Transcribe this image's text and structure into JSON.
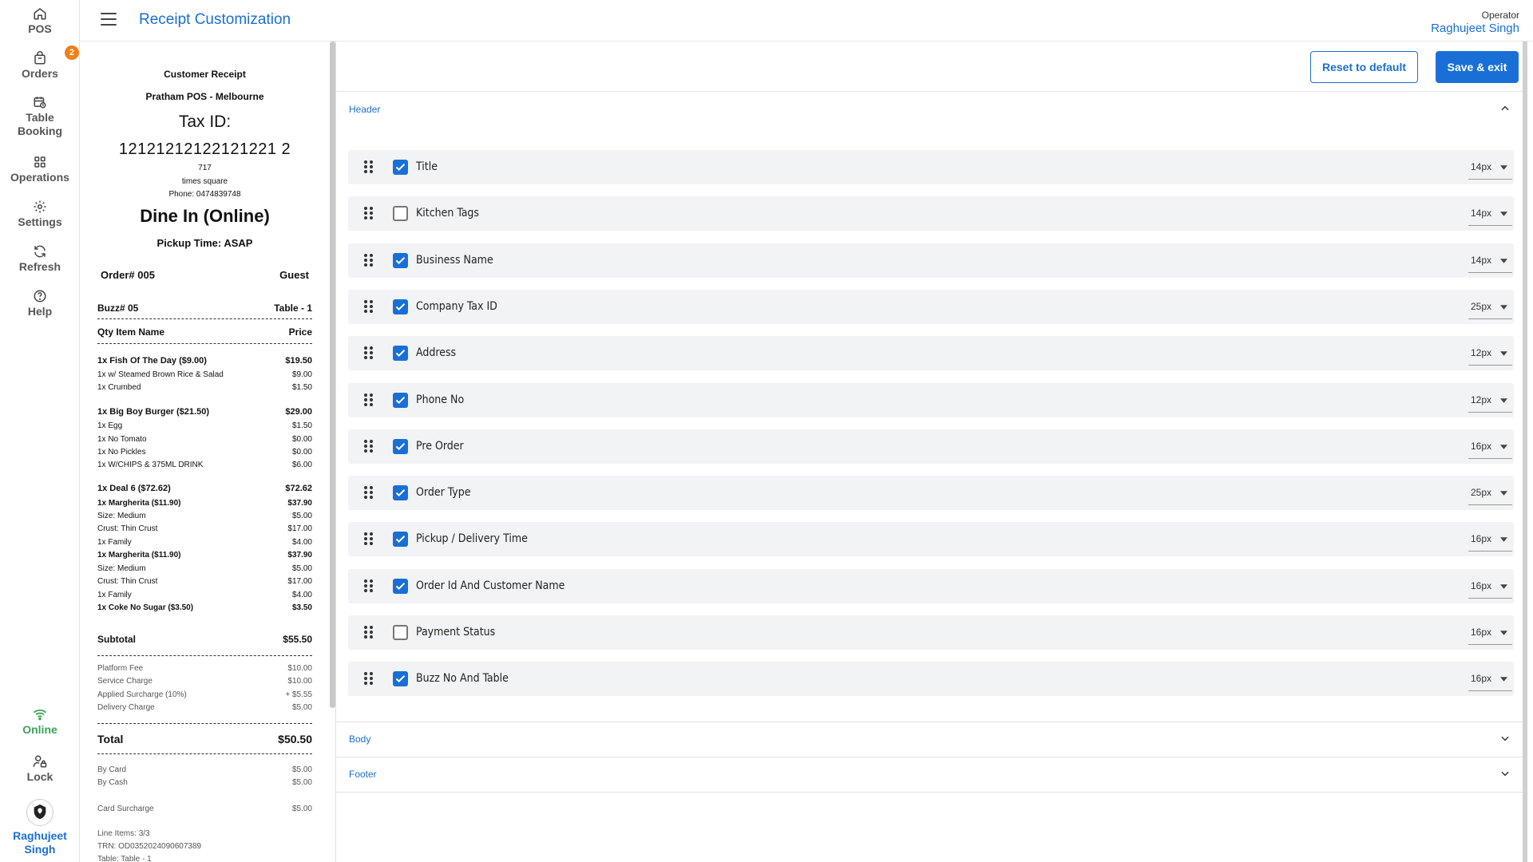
{
  "sidebar": {
    "pos": "POS",
    "orders": "Orders",
    "orders_badge": "2",
    "table_booking_1": "Table",
    "table_booking_2": "Booking",
    "operations": "Operations",
    "settings": "Settings",
    "refresh": "Refresh",
    "help": "Help",
    "online": "Online",
    "lock": "Lock",
    "user_1": "Raghujeet",
    "user_2": "Singh"
  },
  "header": {
    "title": "Receipt Customization",
    "operator_label": "Operator",
    "operator_name": "Raghujeet Singh"
  },
  "receipt": {
    "title": "Customer Receipt",
    "business": "Pratham POS - Melbourne",
    "tax_label": "Tax ID:",
    "tax_id": "12121212122121221 2",
    "address": "717",
    "address2": "times square",
    "phone": "Phone: 0474839748",
    "order_type": "Dine In (Online)",
    "pickup": "Pickup Time: ASAP",
    "order_no": "Order# 005",
    "customer": "Guest",
    "buzz": "Buzz# 05",
    "table": "Table - 1",
    "col_qty_item": "Qty  Item Name",
    "col_price": "Price",
    "items": [
      {
        "text": "1x Fish Of The Day ($9.00)",
        "price": "$19.50"
      },
      {
        "text": "1x w/ Steamed Brown Rice & Salad",
        "price": "$9.00"
      },
      {
        "text": "1x Crumbed",
        "price": "$1.50"
      },
      {
        "text": "1x Big Boy Burger ($21.50)",
        "price": "$29.00"
      },
      {
        "text": "1x Egg",
        "price": "$1.50"
      },
      {
        "text": "1x No Tomato",
        "price": "$0.00"
      },
      {
        "text": "1x No Pickles",
        "price": "$0.00"
      },
      {
        "text": "1x W/CHIPS & 375ML DRINK",
        "price": "$6.00"
      },
      {
        "text": "1x Deal 6 ($72.62)",
        "price": "$72.62"
      },
      {
        "text": "1x Margherita ($11.90)",
        "price": "$37.90"
      },
      {
        "text": "Size: Medium",
        "price": "$5.00"
      },
      {
        "text": "Crust: Thin Crust",
        "price": "$17.00"
      },
      {
        "text": "1x Family",
        "price": "$4.00"
      },
      {
        "text": "1x Margherita ($11.90)",
        "price": "$37.90"
      },
      {
        "text": "Size: Medium",
        "price": "$5.00"
      },
      {
        "text": "Crust: Thin Crust",
        "price": "$17.00"
      },
      {
        "text": "1x Family",
        "price": "$4.00"
      },
      {
        "text": "1x Coke No Sugar ($3.50)",
        "price": "$3.50"
      }
    ],
    "subtotal_label": "Subtotal",
    "subtotal": "$55.50",
    "charges": [
      {
        "text": "Platform Fee",
        "price": "$10.00"
      },
      {
        "text": "Service Charge",
        "price": "$10.00"
      },
      {
        "text": "Applied Surcharge (10%)",
        "price": "+ $5.55"
      },
      {
        "text": "Delivery Charge",
        "price": "$5.00"
      }
    ],
    "total_label": "Total",
    "total": "$50.50",
    "payments": [
      {
        "text": "By Card",
        "price": "$5.00"
      },
      {
        "text": "By Cash",
        "price": "$5.00"
      }
    ],
    "card_surcharge_label": "Card Surcharge",
    "card_surcharge": "$5.00",
    "line_items": "Line Items: 3/3",
    "trn": "TRN: OD0352024090607389",
    "table_footer": "Table: Table - 1"
  },
  "actions": {
    "reset": "Reset to default",
    "save": "Save & exit"
  },
  "sections": {
    "header": "Header",
    "body": "Body",
    "footer": "Footer"
  },
  "header_fields": [
    {
      "label": "Title",
      "checked": true,
      "size": "14px"
    },
    {
      "label": "Kitchen Tags",
      "checked": false,
      "size": "14px"
    },
    {
      "label": "Business Name",
      "checked": true,
      "size": "14px"
    },
    {
      "label": "Company Tax ID",
      "checked": true,
      "size": "25px"
    },
    {
      "label": "Address",
      "checked": true,
      "size": "12px"
    },
    {
      "label": "Phone No",
      "checked": true,
      "size": "12px"
    },
    {
      "label": "Pre Order",
      "checked": true,
      "size": "16px"
    },
    {
      "label": "Order Type",
      "checked": true,
      "size": "25px"
    },
    {
      "label": "Pickup / Delivery Time",
      "checked": true,
      "size": "16px"
    },
    {
      "label": "Order Id And Customer Name",
      "checked": true,
      "size": "16px"
    },
    {
      "label": "Payment Status",
      "checked": false,
      "size": "16px"
    },
    {
      "label": "Buzz No And Table",
      "checked": true,
      "size": "16px"
    }
  ],
  "colors": {
    "accent": "#1a6fd6",
    "badge": "#f0801a",
    "online": "#3aa357"
  }
}
